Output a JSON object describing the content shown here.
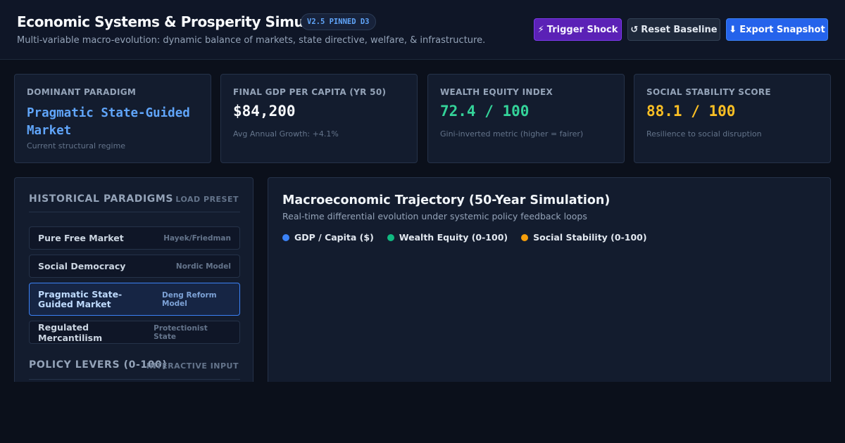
{
  "header": {
    "title": "Economic Systems & Prosperity Simulator",
    "version_badge": "V2.5 PINNED D3",
    "subtitle": "Multi-variable macro-evolution: dynamic balance of markets, state directive, welfare, & infrastructure.",
    "buttons": {
      "shock_icon": "⚡",
      "shock_label": "Trigger Shock",
      "reset_icon": "↺",
      "reset_label": "Reset Baseline",
      "export_icon": "⬇",
      "export_label": "Export Snapshot"
    }
  },
  "kpis": [
    {
      "label": "DOMINANT PARADIGM",
      "value": "Pragmatic State-Guided Market",
      "sub": "Current structural regime",
      "color": "#60a5fa"
    },
    {
      "label": "FINAL GDP PER CAPITA (YR 50)",
      "value": "$84,200",
      "sub": "Avg Annual Growth: +4.1%",
      "color": "#f8fafc"
    },
    {
      "label": "WEALTH EQUITY INDEX",
      "value": "72.4 / 100",
      "sub": "Gini-inverted metric (higher = fairer)",
      "color": "#34d399"
    },
    {
      "label": "SOCIAL STABILITY SCORE",
      "value": "88.1 / 100",
      "sub": "Resilience to social disruption",
      "color": "#fbbf24"
    }
  ],
  "sidebar": {
    "section_title": "HISTORICAL PARADIGMS",
    "section_action": "LOAD PRESET",
    "presets": [
      {
        "name": "Pure Free Market",
        "tag": "Hayek/Friedman",
        "active": false
      },
      {
        "name": "Social Democracy",
        "tag": "Nordic Model",
        "active": false
      },
      {
        "name": "Pragmatic State-Guided Market",
        "tag": "Deng Reform Model",
        "active": true
      },
      {
        "name": "Regulated Mercantilism",
        "tag": "Protectionist State",
        "active": false
      }
    ],
    "levers_title": "POLICY LEVERS (0-100)",
    "levers_action": "INTERACTIVE INPUT"
  },
  "chart": {
    "title": "Macroeconomic Trajectory (50-Year Simulation)",
    "subtitle": "Real-time differential evolution under systemic policy feedback loops",
    "legend": [
      {
        "label": "GDP / Capita ($)",
        "color": "#3b82f6"
      },
      {
        "label": "Wealth Equity (0-100)",
        "color": "#10b981"
      },
      {
        "label": "Social Stability (0-100)",
        "color": "#f59e0b"
      }
    ]
  }
}
